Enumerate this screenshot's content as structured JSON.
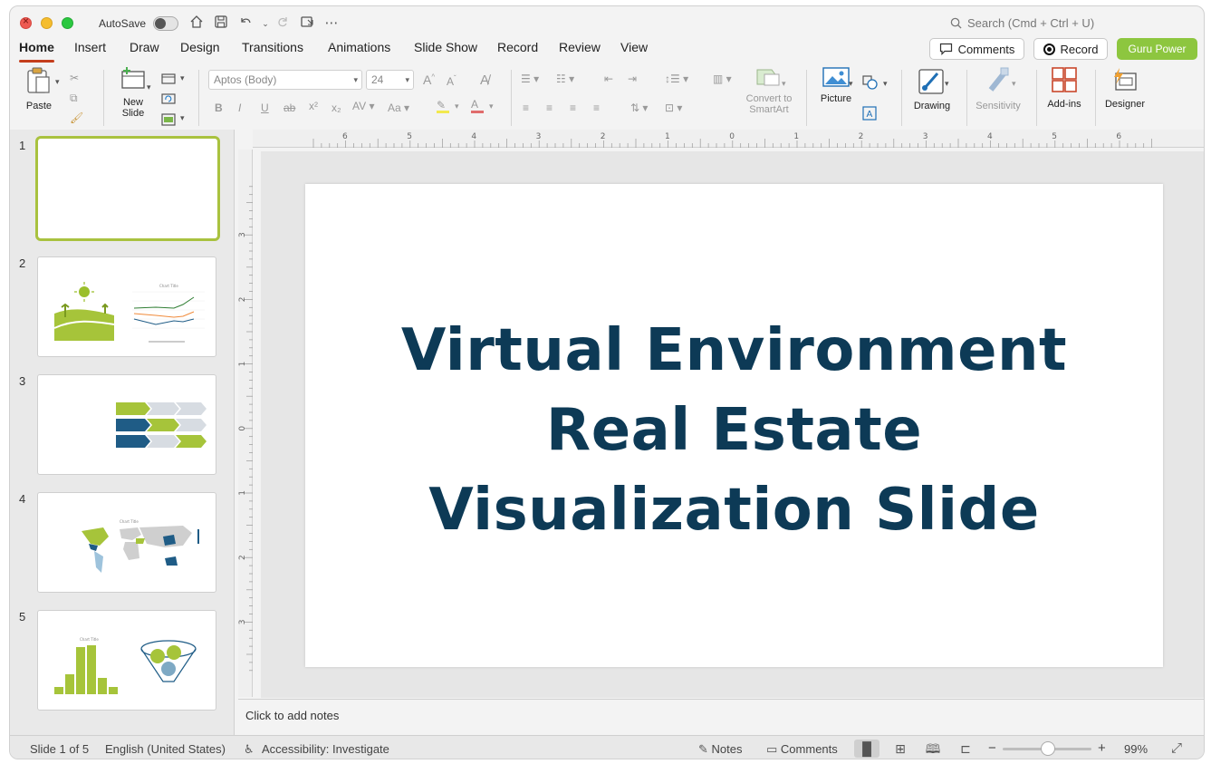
{
  "titlebar": {
    "autosave_label": "AutoSave",
    "search_placeholder": "Search (Cmd + Ctrl + U)"
  },
  "tabs": [
    "Home",
    "Insert",
    "Draw",
    "Design",
    "Transitions",
    "Animations",
    "Slide Show",
    "Record",
    "Review",
    "View"
  ],
  "top_buttons": {
    "comments": "Comments",
    "record": "Record",
    "guru": "Guru Power"
  },
  "ribbon": {
    "paste": "Paste",
    "new_slide": "New\nSlide",
    "font_name": "Aptos (Body)",
    "font_size": "24",
    "convert_smartart": "Convert to\nSmartArt",
    "picture": "Picture",
    "drawing": "Drawing",
    "sensitivity": "Sensitivity",
    "addins": "Add-ins",
    "designer": "Designer"
  },
  "slides": [
    {
      "number": "1",
      "selected": true
    },
    {
      "number": "2"
    },
    {
      "number": "3"
    },
    {
      "number": "4"
    },
    {
      "number": "5"
    }
  ],
  "slide": {
    "title_line1": "Virtual Environment",
    "title_line2": "Real Estate",
    "title_line3": "Visualization Slide"
  },
  "notes_placeholder": "Click to add notes",
  "ruler": {
    "h_ticks": [
      "6",
      "5",
      "4",
      "3",
      "2",
      "1",
      "0",
      "1",
      "2",
      "3",
      "4",
      "5",
      "6"
    ],
    "v_ticks": [
      "3",
      "2",
      "1",
      "0",
      "1",
      "2",
      "3"
    ]
  },
  "status": {
    "slide_info": "Slide 1 of 5",
    "language": "English (United States)",
    "accessibility": "Accessibility: Investigate",
    "notes": "Notes",
    "comments": "Comments",
    "zoom": "99%"
  },
  "colors": {
    "accent_green": "#8dc63f",
    "title_navy": "#0d3a56",
    "home_underline": "#c43e1c",
    "thumb_green": "#a9c23f",
    "thumb_blue": "#1f5c86"
  }
}
